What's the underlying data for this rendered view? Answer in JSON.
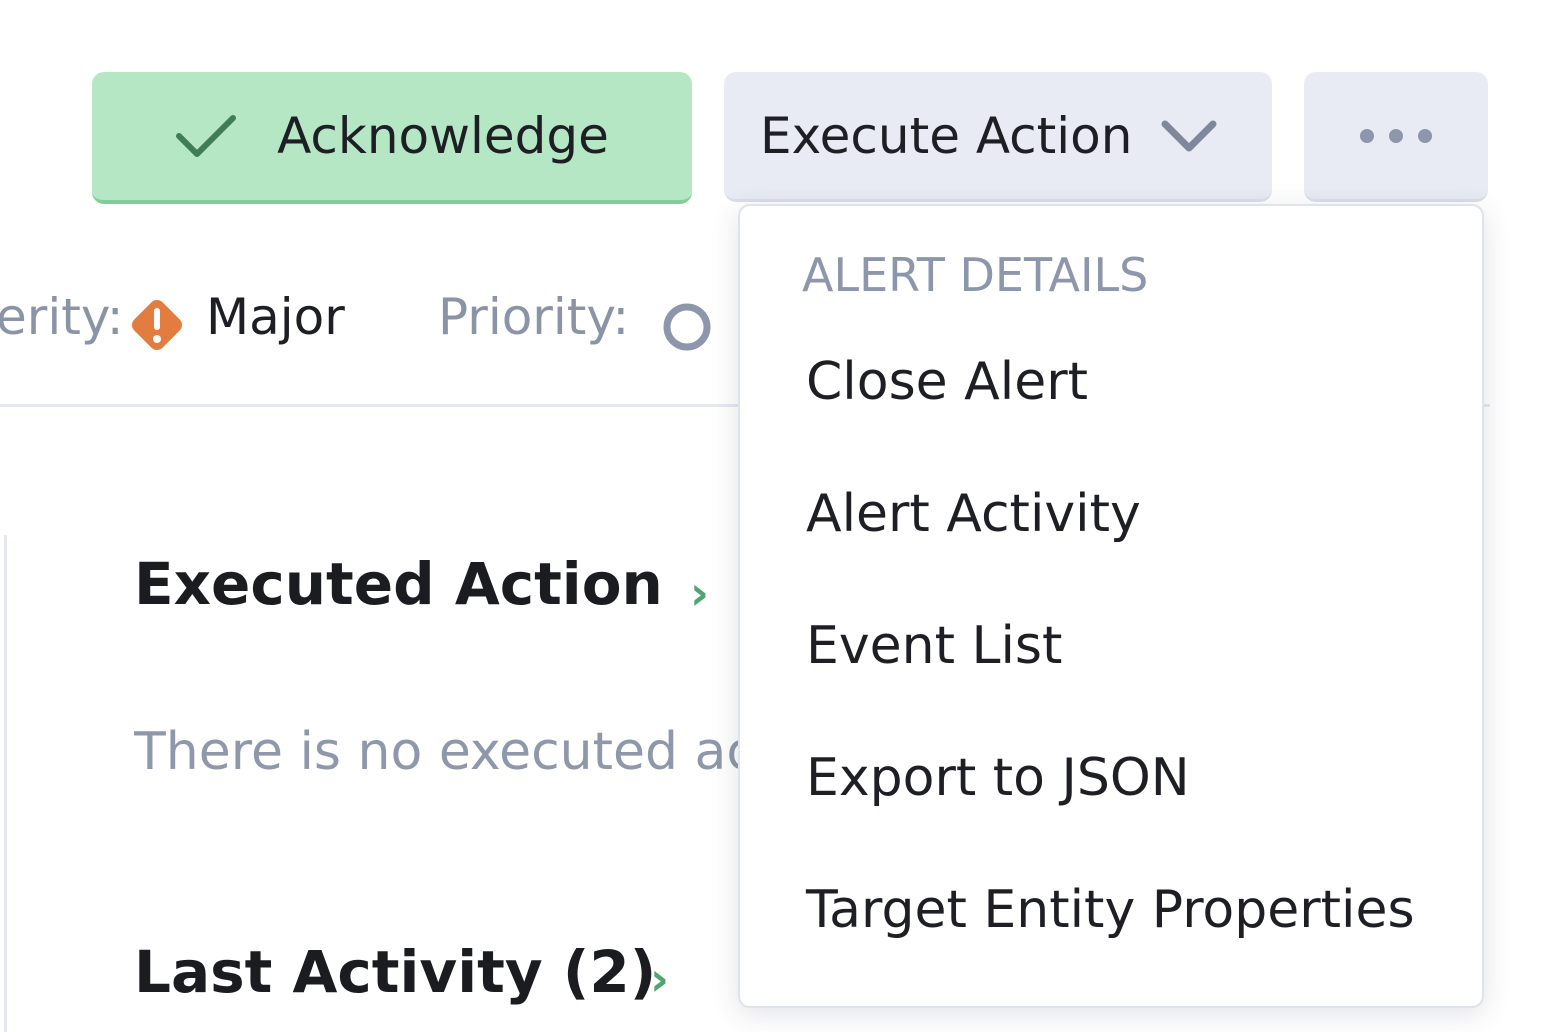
{
  "toolbar": {
    "acknowledge_label": "Acknowledge",
    "execute_action_label": "Execute Action",
    "more_icon": "ellipsis-icon"
  },
  "meta": {
    "severity_label": "erity:",
    "severity_value": "Major",
    "severity_icon": "warning-diamond-icon",
    "priority_label": "Priority:",
    "priority_icon": "empty-circle-icon"
  },
  "content": {
    "executed_action_title": "Executed Action",
    "executed_action_empty": "There is no executed ac",
    "last_activity_title": "Last Activity (2)"
  },
  "dropdown": {
    "header": "ALERT DETAILS",
    "items": [
      {
        "label": "Close Alert"
      },
      {
        "label": "Alert Activity"
      },
      {
        "label": "Event List"
      },
      {
        "label": "Export to JSON"
      },
      {
        "label": "Target Entity Properties"
      }
    ]
  },
  "colors": {
    "acknowledge_bg": "#b5e7c5",
    "check_green": "#3f7d56",
    "severity_orange": "#e37d3f",
    "arrow_green": "#4fa670",
    "muted_text": "#8b93a7"
  }
}
